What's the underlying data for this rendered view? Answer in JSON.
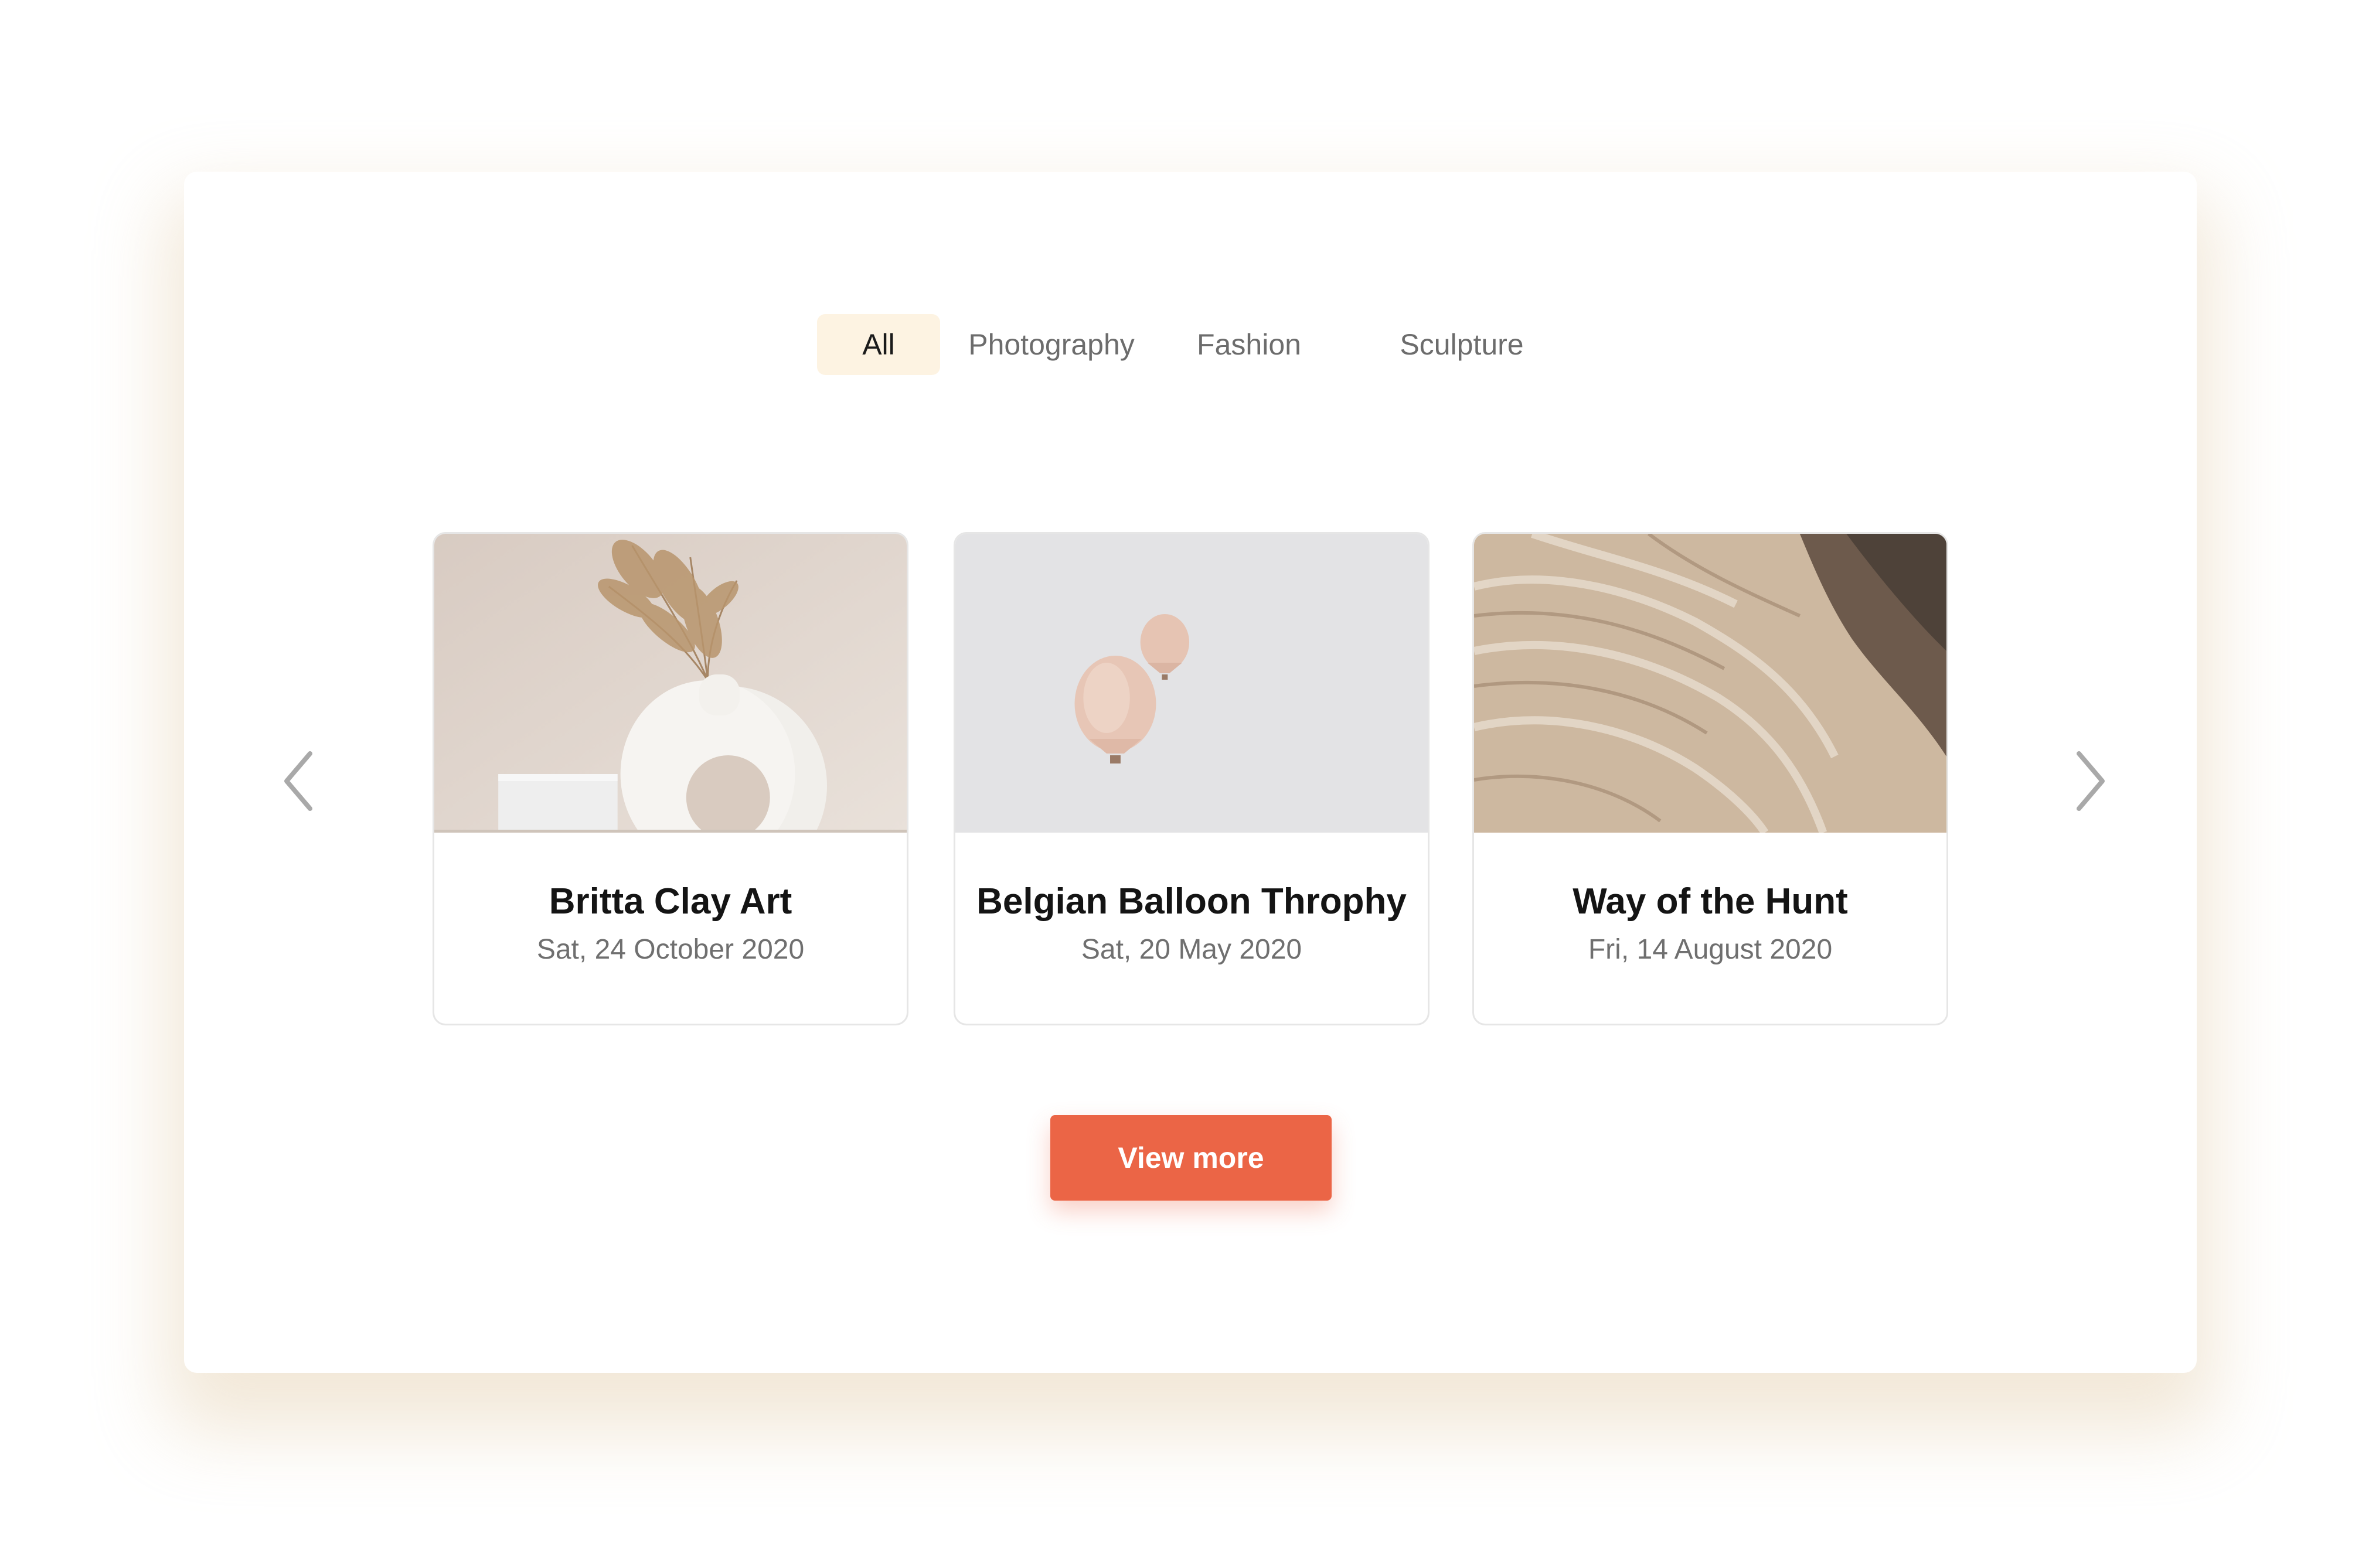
{
  "tabs": [
    {
      "label": "All",
      "active": true
    },
    {
      "label": "Photography",
      "active": false
    },
    {
      "label": "Fashion",
      "active": false
    },
    {
      "label": "Sculpture",
      "active": false
    }
  ],
  "carousel": {
    "prev_icon": "chevron-left-icon",
    "next_icon": "chevron-right-icon",
    "cards": [
      {
        "title": "Britta Clay Art",
        "date": "Sat, 24 October 2020",
        "image": "clay-vase-image"
      },
      {
        "title": "Belgian Balloon Throphy",
        "date": "Sat, 20 May 2020",
        "image": "hot-air-balloons-image"
      },
      {
        "title": "Way of the Hunt",
        "date": "Fri, 14 August 2020",
        "image": "desert-canyon-image"
      }
    ]
  },
  "view_more_label": "View more",
  "colors": {
    "accent": "#eb6546",
    "active_tab_bg": "#fdf3e2",
    "panel_shadow": "#e2cca8"
  }
}
